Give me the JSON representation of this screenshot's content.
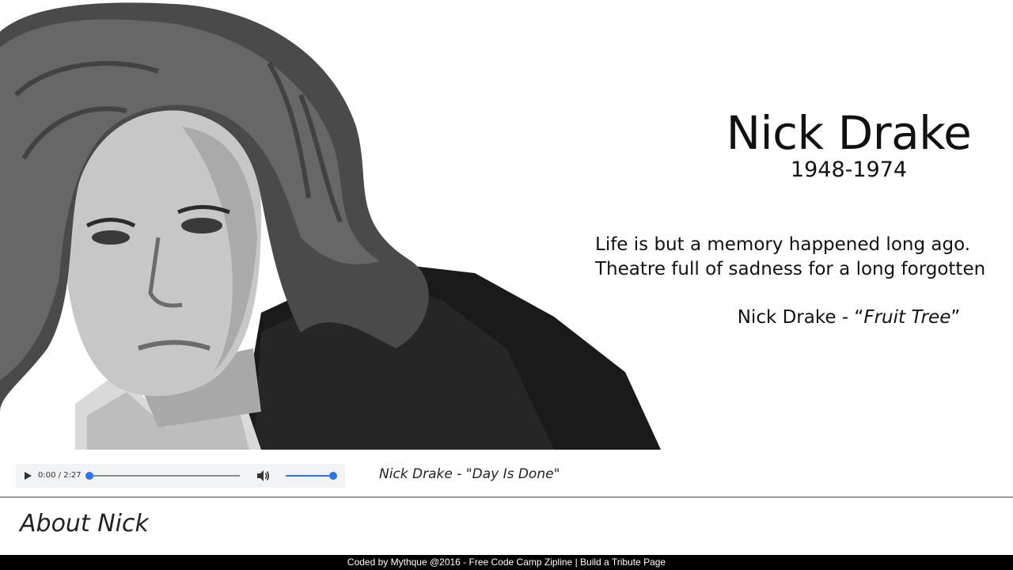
{
  "hero": {
    "portrait_alt": "Nick Drake portrait",
    "name": "Nick Drake",
    "years": "1948-1974",
    "lyric_line_1": "Life is but a memory happened long ago.",
    "lyric_line_2": "Theatre full of sadness for a long forgotten",
    "lyric_credit_prefix": "Nick Drake - “",
    "lyric_credit_song": "Fruit Tree",
    "lyric_credit_suffix": "”"
  },
  "player": {
    "current_time": "0:00",
    "separator": " / ",
    "duration": "2:27",
    "progress_fraction": 0.0,
    "volume_fraction": 1.0,
    "play_icon": "play-icon",
    "volume_icon": "volume-icon",
    "song_caption": "Nick Drake - \"Day Is Done\""
  },
  "about": {
    "label": "About Nick"
  },
  "footer": {
    "text": "Coded by Mythque @2016 - Free Code Camp Zipline | Build a Tribute Page"
  },
  "colors": {
    "accent": "#2f74e0",
    "footer_bg": "#000000",
    "player_bg": "#f1f3f4",
    "divider": "#9a9a9a"
  }
}
